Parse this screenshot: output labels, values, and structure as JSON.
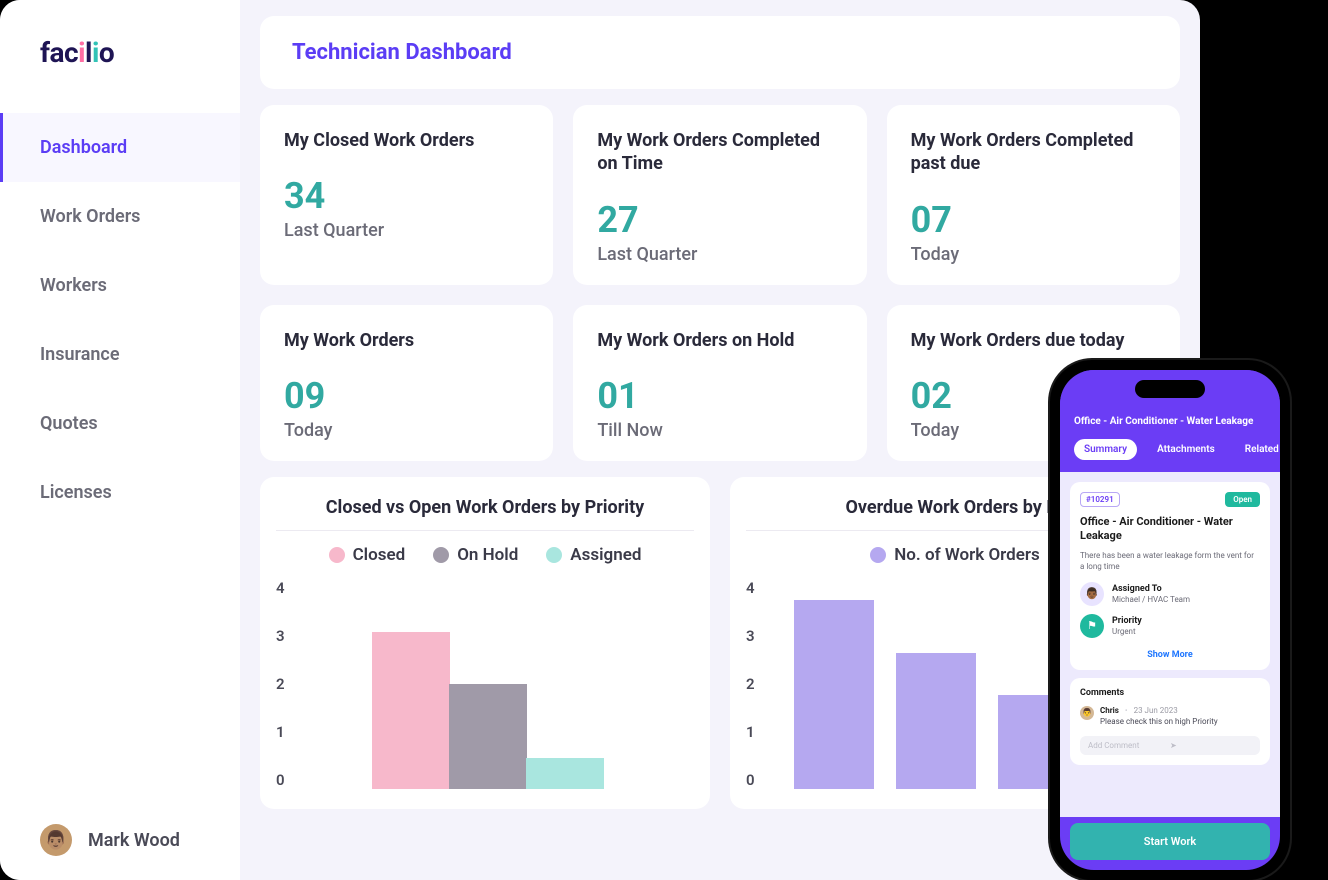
{
  "logo": "facilio",
  "sidebar": {
    "items": [
      "Dashboard",
      "Work Orders",
      "Workers",
      "Insurance",
      "Quotes",
      "Licenses"
    ],
    "activeIndex": 0,
    "user": {
      "name": "Mark Wood"
    }
  },
  "header": {
    "title": "Technician Dashboard"
  },
  "stats": [
    {
      "title": "My Closed Work Orders",
      "value": "34",
      "label": "Last Quarter"
    },
    {
      "title": "My Work Orders Completed on Time",
      "value": "27",
      "label": "Last Quarter"
    },
    {
      "title": "My Work Orders Completed past due",
      "value": "07",
      "label": "Today"
    },
    {
      "title": "My Work Orders",
      "value": "09",
      "label": "Today"
    },
    {
      "title": "My Work Orders on Hold",
      "value": "01",
      "label": "Till Now"
    },
    {
      "title": "My Work Orders due today",
      "value": "02",
      "label": "Today"
    }
  ],
  "chart1": {
    "title": "Closed vs Open Work Orders by Priority",
    "legend": [
      {
        "label": "Closed",
        "color": "#f7b8cb"
      },
      {
        "label": "On Hold",
        "color": "#a09aa8"
      },
      {
        "label": "Assigned",
        "color": "#a9e6df"
      }
    ],
    "yticks": [
      "4",
      "3",
      "2",
      "1",
      "0"
    ]
  },
  "chart2": {
    "title": "Overdue Work Orders by Pr",
    "legend": [
      {
        "label": "No. of Work Orders",
        "color": "#b5a8f0"
      }
    ],
    "yticks": [
      "4",
      "3",
      "2",
      "1",
      "0"
    ]
  },
  "chart_data": [
    {
      "type": "bar",
      "title": "Closed vs Open Work Orders by Priority",
      "ylim": [
        0,
        4
      ],
      "categories": [
        "Closed",
        "On Hold",
        "Assigned"
      ],
      "values": [
        3,
        2,
        0.6
      ],
      "colors": [
        "#f7b8cb",
        "#a09aa8",
        "#a9e6df"
      ]
    },
    {
      "type": "bar",
      "title": "Overdue Work Orders by Priority",
      "ylabel": "No. of Work Orders",
      "ylim": [
        0,
        4
      ],
      "categories": [
        "",
        "",
        ""
      ],
      "values": [
        3.6,
        2.6,
        1.8
      ],
      "colors": [
        "#b5a8f0",
        "#b5a8f0",
        "#b5a8f0"
      ]
    }
  ],
  "phone": {
    "title": "Office - Air Conditioner - Water Leakage",
    "tabs": [
      "Summary",
      "Attachments",
      "Related"
    ],
    "activeTab": 0,
    "wo": {
      "id": "#10291",
      "status": "Open",
      "title": "Office - Air Conditioner - Water Leakage",
      "desc": "There has been a water leakage form the vent for a long time",
      "assignedTo": {
        "label": "Assigned To",
        "value": "Michael / HVAC Team"
      },
      "priority": {
        "label": "Priority",
        "value": "Urgent"
      },
      "showMore": "Show More"
    },
    "comments": {
      "title": "Comments",
      "items": [
        {
          "name": "Chris",
          "date": "23 Jun 2023",
          "text": "Please check this on high Priority"
        }
      ],
      "placeholder": "Add Comment"
    },
    "button": "Start Work"
  }
}
